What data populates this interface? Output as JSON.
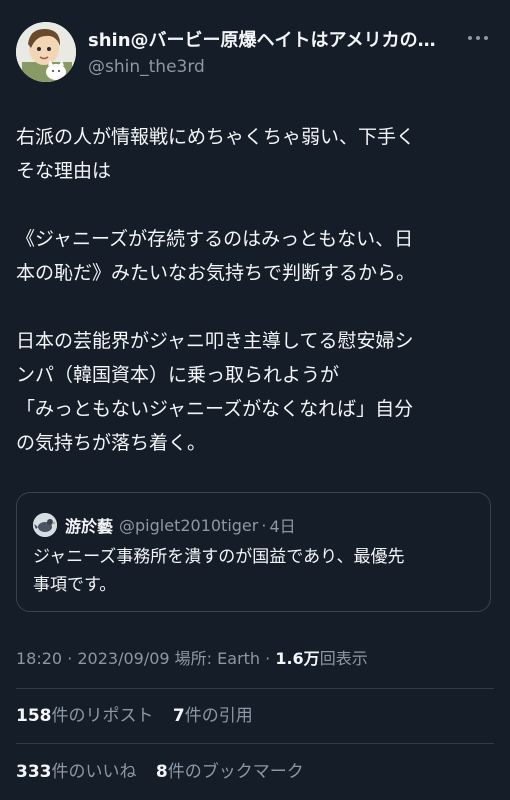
{
  "author": {
    "display_name": "shin@バービー原爆ヘイトはアメリカの…",
    "handle": "@shin_the3rd",
    "avatar_icon": "cartoon-person-with-cat-avatar"
  },
  "more_icon": "more-horizontal-icon",
  "tweet_lines": [
    "右派の人が情報戦にめちゃくちゃ弱い、下手く",
    "そな理由は",
    "",
    "《ジャニーズが存続するのはみっともない、日",
    "本の恥だ》みたいなお気持ちで判断するから。",
    "",
    "日本の芸能界がジャニ叩き主導してる慰安婦シ",
    "ンパ（韓国資本）に乗っ取られようが",
    "「みっともないジャニーズがなくなれば」自分",
    "の気持ちが落ち着く。"
  ],
  "quote": {
    "name": "游於藝",
    "handle": "@piglet2010tiger",
    "dot": "·",
    "date": "4日",
    "avatar_icon": "bird-avatar",
    "lines": [
      "ジャニーズ事務所を潰すのが国益であり、最優先",
      "事項です。"
    ]
  },
  "meta": {
    "time_date_location": "18:20 · 2023/09/09 場所: Earth · ",
    "views_count": "1.6万",
    "views_label": "回表示"
  },
  "engagement": {
    "reposts_count": "158",
    "reposts_label": "件のリポスト",
    "quotes_count": "7",
    "quotes_label": "件の引用",
    "likes_count": "333",
    "likes_label": "件のいいね",
    "bookmarks_count": "8",
    "bookmarks_label": "件のブックマーク"
  },
  "colors": {
    "background": "#151d28",
    "text": "#f3f5f7",
    "secondary": "#8b98a5",
    "border": "#38444d"
  }
}
